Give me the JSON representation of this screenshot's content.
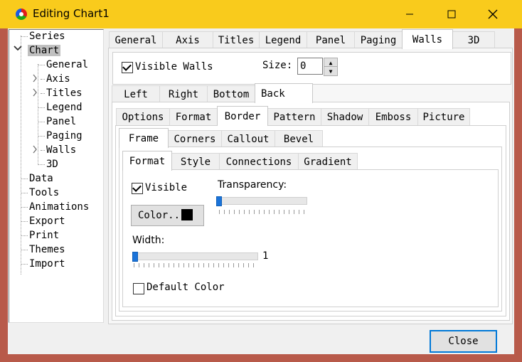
{
  "window": {
    "title": "Editing Chart1"
  },
  "tree": {
    "items": [
      {
        "label": "Series"
      },
      {
        "label": "Chart"
      },
      {
        "label": "General"
      },
      {
        "label": "Axis"
      },
      {
        "label": "Titles"
      },
      {
        "label": "Legend"
      },
      {
        "label": "Panel"
      },
      {
        "label": "Paging"
      },
      {
        "label": "Walls"
      },
      {
        "label": "3D"
      },
      {
        "label": "Data"
      },
      {
        "label": "Tools"
      },
      {
        "label": "Animations"
      },
      {
        "label": "Export"
      },
      {
        "label": "Print"
      },
      {
        "label": "Themes"
      },
      {
        "label": "Import"
      }
    ],
    "selected": "Chart"
  },
  "top_tabs": [
    "General",
    "Axis",
    "Titles",
    "Legend",
    "Panel",
    "Paging",
    "Walls",
    "3D"
  ],
  "walls": {
    "visible_label": "Visible Walls",
    "visible_checked": true,
    "size_label": "Size:",
    "size_value": "0"
  },
  "wall_tabs": [
    "Left",
    "Right",
    "Bottom",
    "Back"
  ],
  "back_tabs": [
    "Options",
    "Format",
    "Border",
    "Pattern",
    "Shadow",
    "Emboss",
    "Picture"
  ],
  "border_tabs": [
    "Frame",
    "Corners",
    "Callout",
    "Bevel"
  ],
  "frame_tabs": [
    "Format",
    "Style",
    "Connections",
    "Gradient"
  ],
  "frame": {
    "visible_label": "Visible",
    "visible_checked": true,
    "transparency_label": "Transparency:",
    "transparency_value": 0,
    "color_button_label": "Color..",
    "color_swatch": "#000000",
    "width_label": "Width:",
    "width_value": "1",
    "default_color_label": "Default Color",
    "default_color_checked": false
  },
  "footer": {
    "close_label": "Close"
  }
}
